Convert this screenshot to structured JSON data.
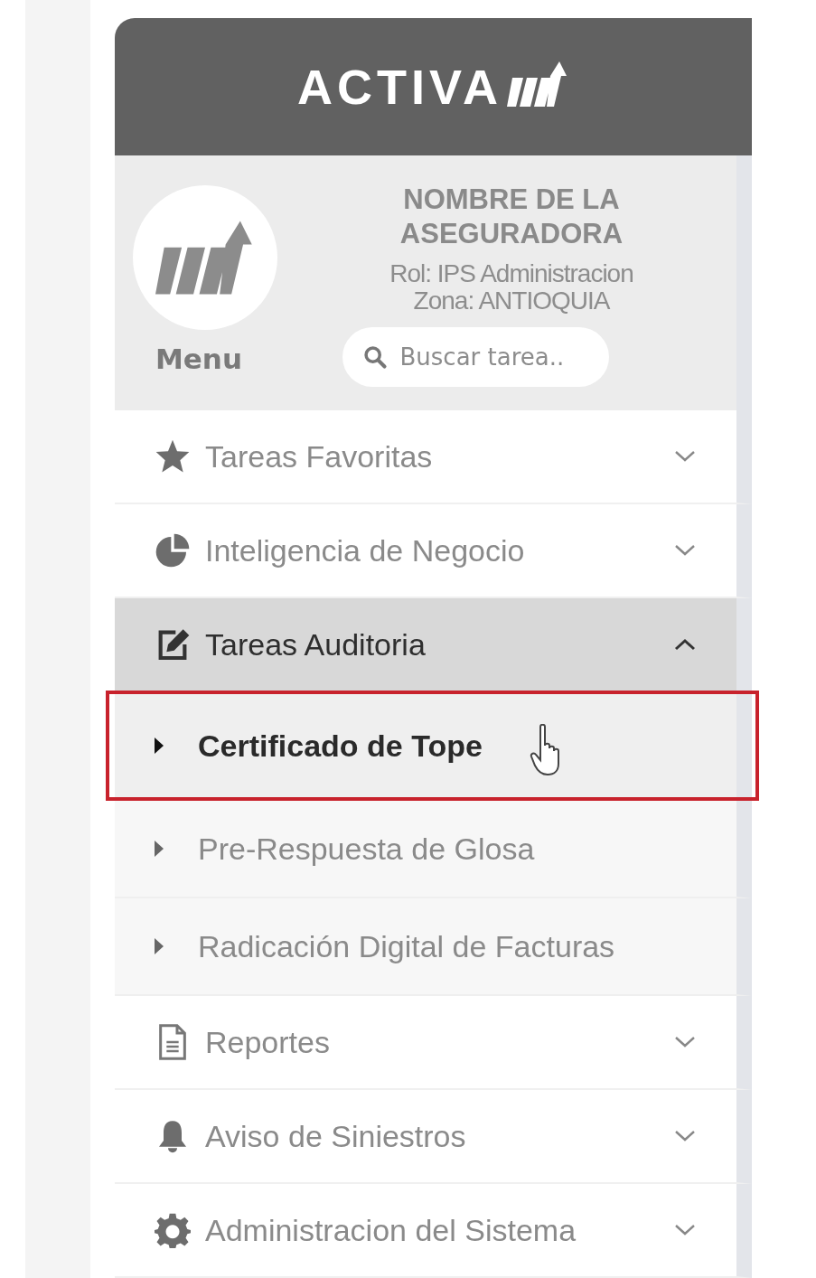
{
  "header": {
    "brand": "ACTIVA"
  },
  "profile": {
    "organization": "NOMBRE DE LA ASEGURADORA",
    "role": "Rol: IPS Administracion",
    "zone": "Zona: ANTIOQUIA",
    "menu_label": "Menu"
  },
  "search": {
    "placeholder": "Buscar tarea.."
  },
  "menu": [
    {
      "label": "Tareas Favoritas",
      "expanded": false
    },
    {
      "label": "Inteligencia de Negocio",
      "expanded": false
    },
    {
      "label": "Tareas Auditoria",
      "expanded": true,
      "children": [
        {
          "label": "Certificado de Tope",
          "selected": true,
          "annotated": true
        },
        {
          "label": "Pre-Respuesta de Glosa",
          "selected": false,
          "annotated": false
        },
        {
          "label": "Radicación Digital de Facturas",
          "selected": false,
          "annotated": false
        }
      ]
    },
    {
      "label": "Reportes",
      "expanded": false
    },
    {
      "label": "Aviso de Siniestros",
      "expanded": false
    },
    {
      "label": "Administracion del Sistema",
      "expanded": false
    }
  ]
}
